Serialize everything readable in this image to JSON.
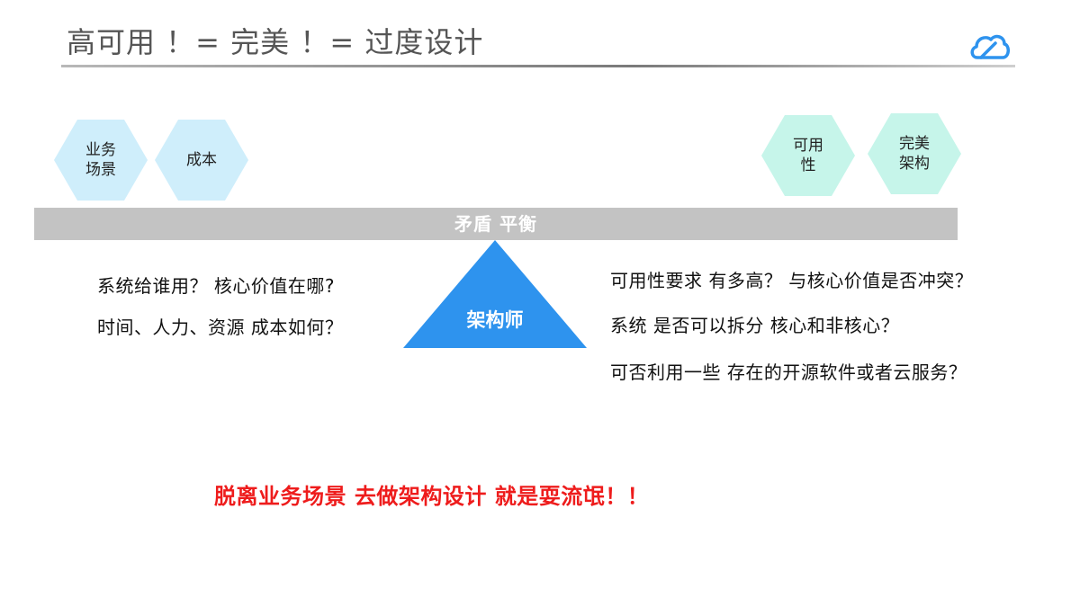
{
  "title": "高可用 ！= 完美 ！= 过度设计",
  "logo_icon": "cloud-icon",
  "colors": {
    "accent_blue": "#2e93ee",
    "hex_blue": "#cfeefb",
    "hex_green": "#c6f5ea",
    "beam_gray": "#c3c3c3",
    "warning_red": "#ee1c1c"
  },
  "left_hexagons": [
    {
      "label": "业务\n场景"
    },
    {
      "label": "成本"
    }
  ],
  "right_hexagons": [
    {
      "label": "可用\n性"
    },
    {
      "label": "完美\n架构"
    }
  ],
  "balance_label": "矛盾 平衡",
  "fulcrum_label": "架构师",
  "left_questions": [
    "系统给谁用？ 核心价值在哪?",
    "时间、人力、资源 成本如何？"
  ],
  "right_questions": [
    "可用性要求 有多高？ 与核心价值是否冲突？",
    "系统 是否可以拆分 核心和非核心？",
    "可否利用一些 存在的开源软件或者云服务？"
  ],
  "warning": "脱离业务场景 去做架构设计 就是耍流氓！！"
}
